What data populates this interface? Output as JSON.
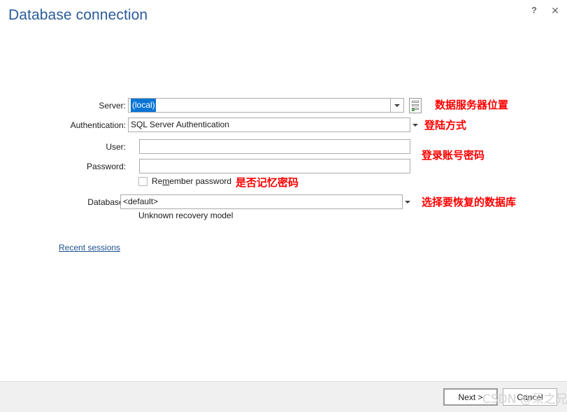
{
  "window": {
    "title": "Database connection",
    "help_icon": "?",
    "close_icon": "✕"
  },
  "form": {
    "server": {
      "label": "Server:",
      "value": "(local)",
      "selected": true,
      "dropdown_icon": "chevron-down-icon",
      "browse_icon": "server-icon"
    },
    "authentication": {
      "label": "Authentication:",
      "value": "SQL Server Authentication",
      "dropdown_icon": "chevron-down-icon"
    },
    "user": {
      "label": "User:",
      "value": "",
      "placeholder": ""
    },
    "password": {
      "label": "Password:",
      "value": "",
      "placeholder": ""
    },
    "remember_password": {
      "label_before": "Re",
      "label_accel": "m",
      "label_after": "ember password",
      "checked": false
    },
    "database": {
      "label": "Database:",
      "value": "<default>",
      "dropdown_icon": "chevron-down-icon",
      "hint": "Unknown recovery model"
    },
    "recent_sessions_link": "Recent sessions"
  },
  "annotations": {
    "server": "数据服务器位置",
    "authentication": "登陆方式",
    "credentials": "登录账号密码",
    "remember_password": "是否记忆密码",
    "database": "选择要恢复的数据库",
    "color": "#FE0000"
  },
  "footer": {
    "next_label": "Next >",
    "cancel_label": "Cancel"
  },
  "watermark": "CSDN @呆之兄"
}
